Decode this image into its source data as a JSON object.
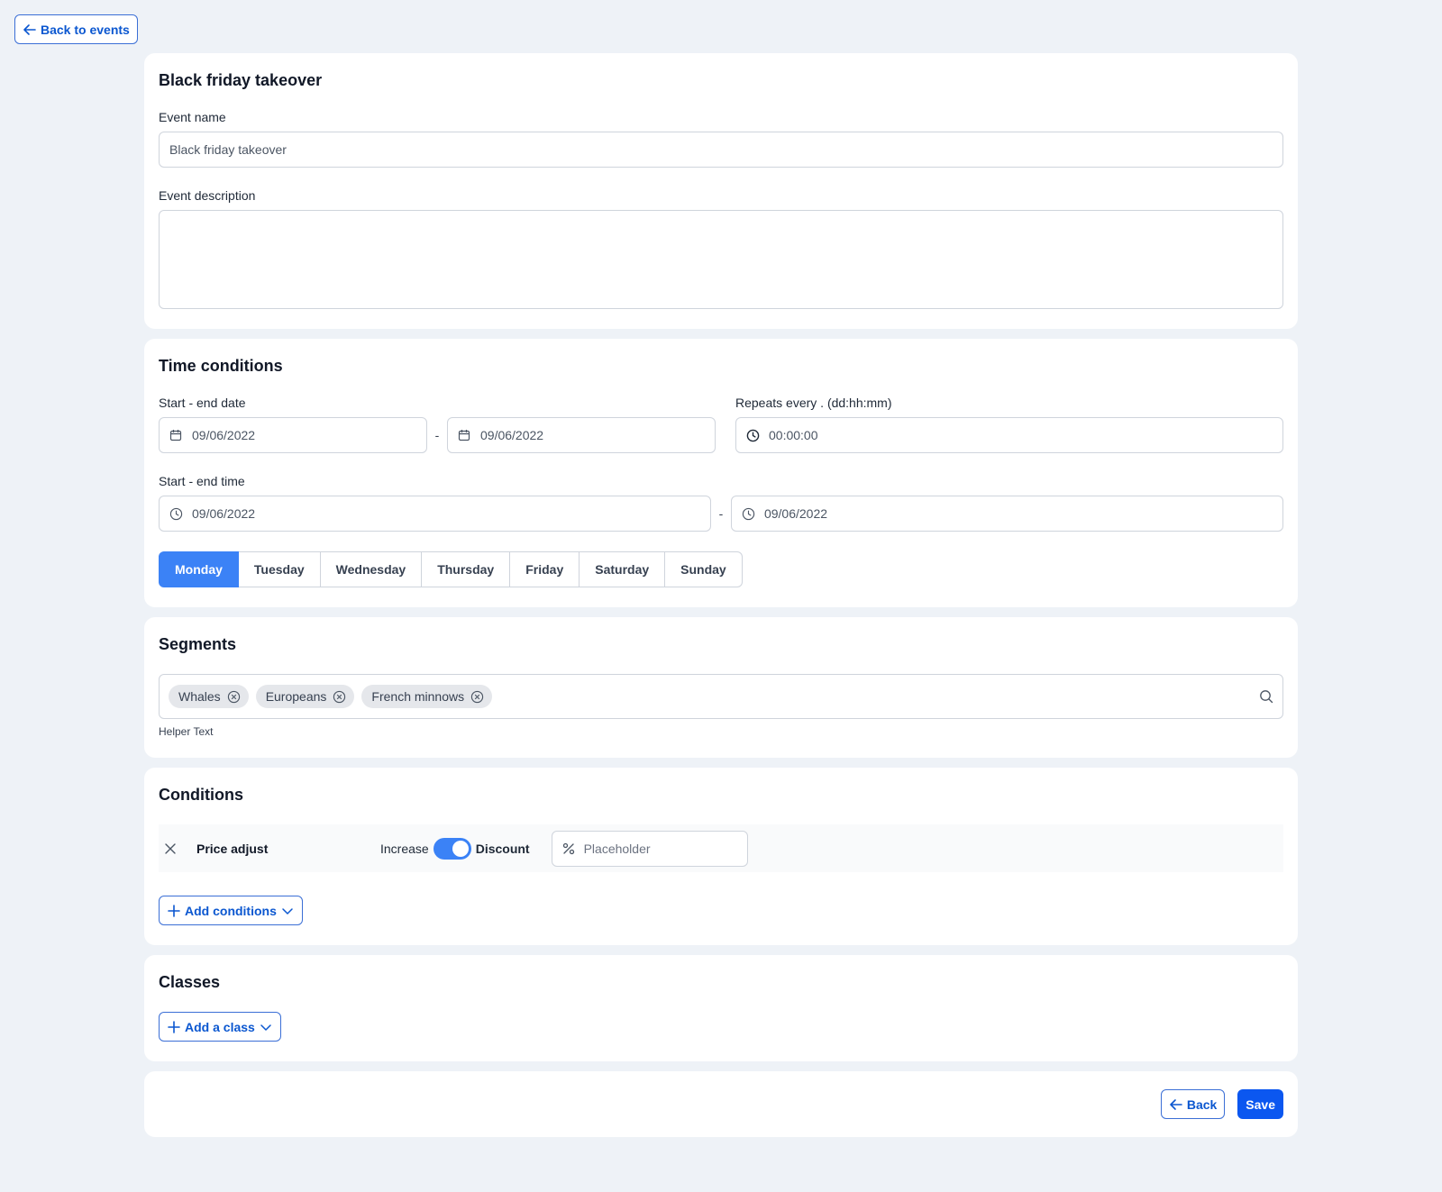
{
  "nav": {
    "back_to_events": "Back to events"
  },
  "event": {
    "title": "Black friday takeover",
    "name_label": "Event name",
    "name_value": "Black friday takeover",
    "description_label": "Event description",
    "description_value": ""
  },
  "time": {
    "title": "Time conditions",
    "date_label": "Start - end date",
    "start_date": "09/06/2022",
    "end_date": "09/06/2022",
    "repeats_label": "Repeats every . (dd:hh:mm)",
    "repeats_value": "00:00:00",
    "time_label": "Start - end time",
    "start_time": "09/06/2022",
    "end_time": "09/06/2022",
    "separator": "-",
    "days": [
      "Monday",
      "Tuesday",
      "Wednesday",
      "Thursday",
      "Friday",
      "Saturday",
      "Sunday"
    ],
    "active_day": "Monday"
  },
  "segments": {
    "title": "Segments",
    "tags": [
      "Whales",
      "Europeans",
      "French minnows"
    ],
    "helper": "Helper Text"
  },
  "conditions": {
    "title": "Conditions",
    "row_name": "Price adjust",
    "toggle_left": "Increase",
    "toggle_right": "Discount",
    "toggle_on": true,
    "input_placeholder": "Placeholder",
    "add_label": "Add conditions"
  },
  "classes": {
    "title": "Classes",
    "add_label": "Add a class"
  },
  "footer": {
    "back_label": "Back",
    "save_label": "Save"
  },
  "colors": {
    "accent": "#3b82f6",
    "primary": "#0b57f0",
    "link": "#0b57d0",
    "background": "#eef2f7"
  }
}
